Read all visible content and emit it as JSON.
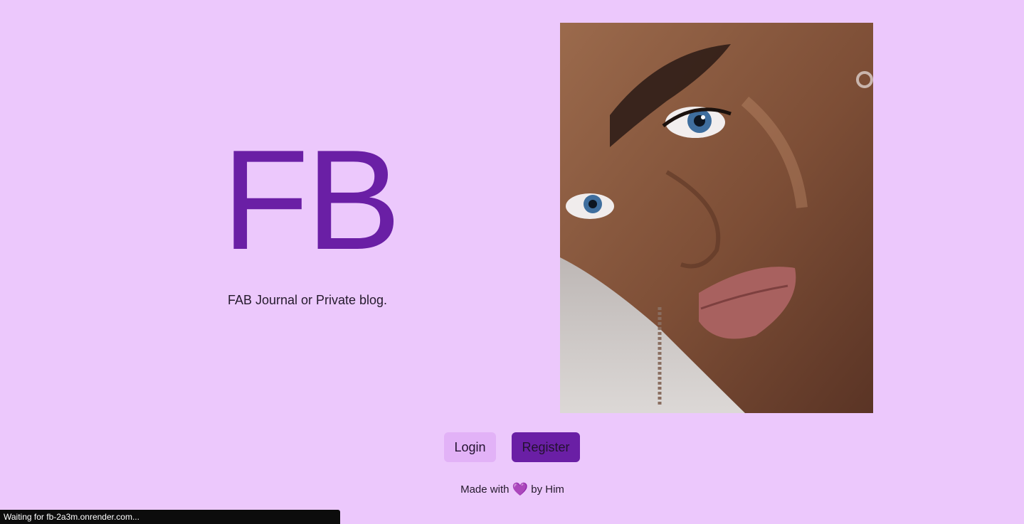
{
  "brand": {
    "logo_text": "FB",
    "tagline": "FAB Journal or Private blog."
  },
  "hero": {
    "image_name": "portrait-photo"
  },
  "actions": {
    "login_label": "Login",
    "register_label": "Register"
  },
  "footer": {
    "prefix": "Made with",
    "heart": "💜",
    "suffix": "by Him"
  },
  "browser_status": {
    "text": "Waiting for fb-2a3m.onrender.com..."
  },
  "colors": {
    "background": "#ecc8fc",
    "accent": "#6a1fa5",
    "login_button": "#e2b2f7"
  }
}
